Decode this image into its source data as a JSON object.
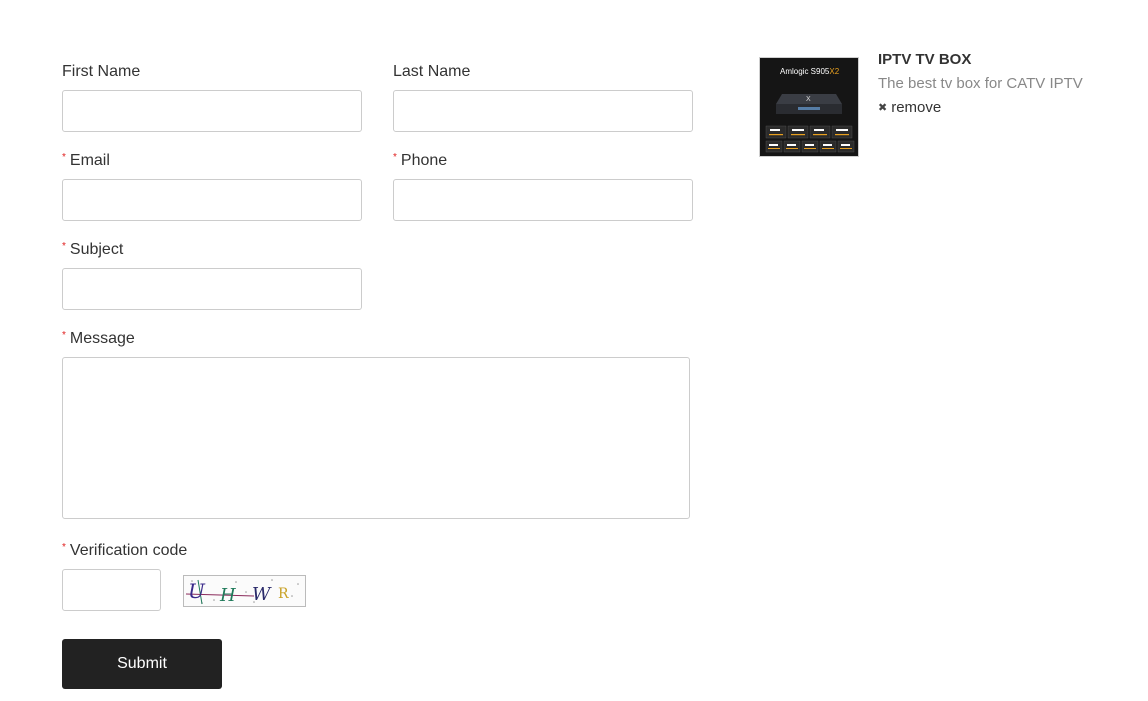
{
  "form": {
    "first_name_label": "First Name",
    "last_name_label": "Last Name",
    "email_label": "Email",
    "phone_label": "Phone",
    "subject_label": "Subject",
    "message_label": "Message",
    "verification_label": "Verification code",
    "required_marker": "*",
    "first_name_value": "",
    "last_name_value": "",
    "email_value": "",
    "phone_value": "",
    "subject_value": "",
    "message_value": "",
    "verification_value": "",
    "submit_label": "Submit"
  },
  "captcha": {
    "text": "UHWR",
    "colors": [
      "#3a2a8a",
      "#1f7a5a",
      "#2a2a6a",
      "#c9a227"
    ]
  },
  "product": {
    "title": "IPTV TV BOX",
    "description": "The best tv box for CATV IPTV",
    "remove_label": "remove",
    "thumb_text": "Amlogic S905X2",
    "thumb_accent": "#e8a020"
  },
  "colors": {
    "submit_bg": "#222222",
    "required": "#e02020"
  }
}
